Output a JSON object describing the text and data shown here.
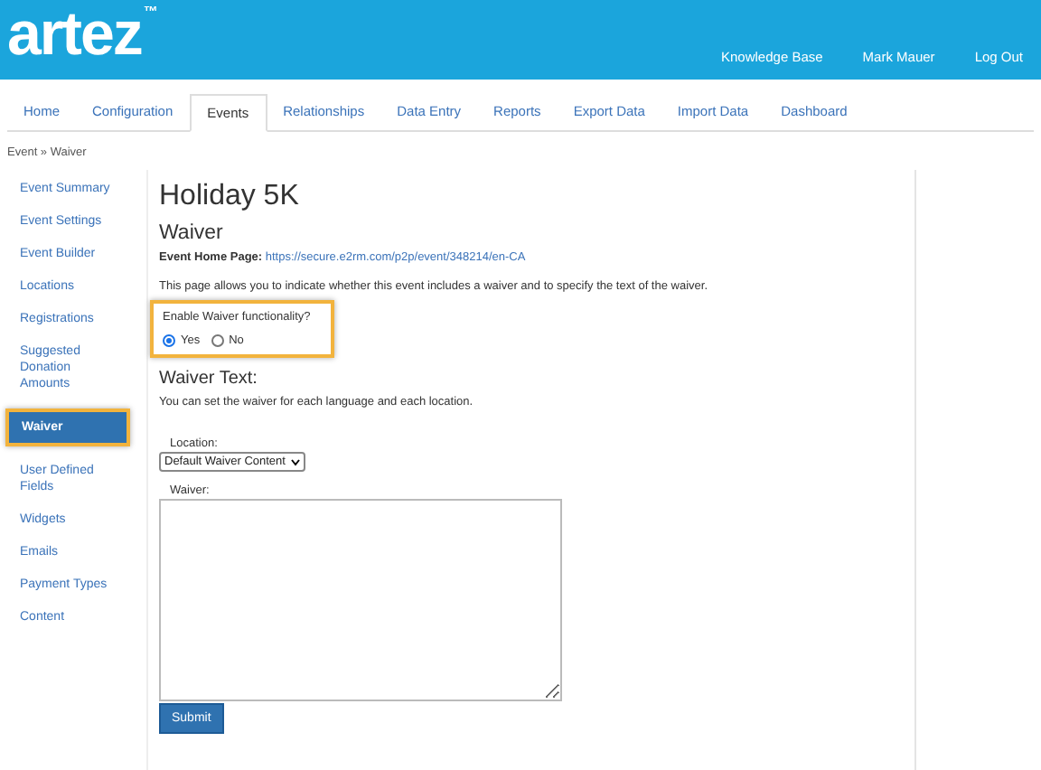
{
  "header": {
    "logo": "artez",
    "trademark": "™",
    "links": [
      "Knowledge Base",
      "Mark Mauer",
      "Log Out"
    ]
  },
  "tabs": [
    {
      "label": "Home",
      "selected": false
    },
    {
      "label": "Configuration",
      "selected": false
    },
    {
      "label": "Events",
      "selected": true
    },
    {
      "label": "Relationships",
      "selected": false
    },
    {
      "label": "Data Entry",
      "selected": false
    },
    {
      "label": "Reports",
      "selected": false
    },
    {
      "label": "Export Data",
      "selected": false
    },
    {
      "label": "Import Data",
      "selected": false
    },
    {
      "label": "Dashboard",
      "selected": false
    }
  ],
  "breadcrumb": "Event » Waiver",
  "sidebar": {
    "items": [
      {
        "label": "Event Summary",
        "selected": false
      },
      {
        "label": "Event Settings",
        "selected": false
      },
      {
        "label": "Event Builder",
        "selected": false
      },
      {
        "label": "Locations",
        "selected": false
      },
      {
        "label": "Registrations",
        "selected": false
      },
      {
        "label": "Suggested Donation Amounts",
        "selected": false
      },
      {
        "label": "Waiver",
        "selected": true
      },
      {
        "label": "User Defined Fields",
        "selected": false
      },
      {
        "label": "Widgets",
        "selected": false
      },
      {
        "label": "Emails",
        "selected": false
      },
      {
        "label": "Payment Types",
        "selected": false
      },
      {
        "label": "Content",
        "selected": false
      }
    ]
  },
  "content": {
    "title": "Holiday 5K",
    "subtitle": "Waiver",
    "home_page_label": "Event Home Page:",
    "home_page_url": "https://secure.e2rm.com/p2p/event/348214/en-CA",
    "description": "This page allows you to indicate whether this event includes a waiver and to specify the text of the waiver.",
    "enable": {
      "question": "Enable Waiver functionality?",
      "highlighted": true,
      "options": [
        {
          "label": "Yes",
          "selected": true
        },
        {
          "label": "No",
          "selected": false
        }
      ]
    },
    "waiver_text_heading": "Waiver Text:",
    "waiver_text_note": "You can set the waiver for each language and each location.",
    "location_label": "Location:",
    "location_value": "Default Waiver Content",
    "waiver_label": "Waiver:",
    "submit": "Submit"
  }
}
